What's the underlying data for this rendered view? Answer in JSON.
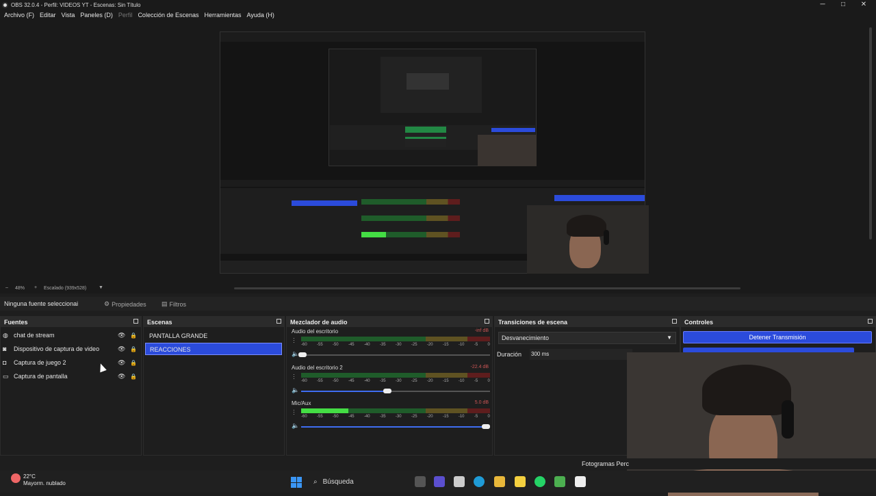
{
  "window": {
    "title": "OBS 32.0.4 - Perfil: VIDEOS YT - Escenas: Sin Título",
    "minimize": "─",
    "maximize": "□",
    "close": "✕"
  },
  "menu": [
    {
      "label": "Archivo (F)",
      "disabled": false
    },
    {
      "label": "Editar",
      "disabled": false
    },
    {
      "label": "Vista",
      "disabled": false
    },
    {
      "label": "Paneles (D)",
      "disabled": false
    },
    {
      "label": "Perfil",
      "disabled": true
    },
    {
      "label": "Colección de Escenas",
      "disabled": false
    },
    {
      "label": "Herramientas",
      "disabled": false
    },
    {
      "label": "Ayuda (H)",
      "disabled": false
    }
  ],
  "zoombar": {
    "minus": "–",
    "zoom": "48%",
    "plus": "+",
    "scale": "Escalado (939x528)"
  },
  "context": {
    "no_source": "Ninguna fuente seleccionai",
    "properties": "Propiedades",
    "filters": "Filtros"
  },
  "sources": {
    "title": "Fuentes",
    "items": [
      {
        "label": "chat de stream",
        "icon": "browser-icon"
      },
      {
        "label": "Dispositivo de captura de video",
        "icon": "camera-icon"
      },
      {
        "label": "Captura de juego 2",
        "icon": "gamepad-icon"
      },
      {
        "label": "Captura de pantalla",
        "icon": "monitor-icon"
      }
    ]
  },
  "scenes": {
    "title": "Escenas",
    "items": [
      {
        "label": "PANTALLA GRANDE",
        "selected": false
      },
      {
        "label": "REACCIONES",
        "selected": true
      }
    ]
  },
  "mixer": {
    "title": "Mezclador de audio",
    "ticks": [
      "-60",
      "-55",
      "-50",
      "-45",
      "-40",
      "-35",
      "-30",
      "-25",
      "-20",
      "-15",
      "-10",
      "-5",
      "0"
    ],
    "channels": [
      {
        "name": "Audio del escritorio",
        "db": "-inf dB",
        "level": 0.0,
        "volume": 0.03
      },
      {
        "name": "Audio del escritorio 2",
        "db": "-22.4 dB",
        "level": 0.0,
        "volume": 0.48
      },
      {
        "name": "Mic/Aux",
        "db": "5.0 dB",
        "level": 0.25,
        "volume": 1.0
      }
    ]
  },
  "transitions": {
    "title": "Transiciones de escena",
    "selected": "Desvanecimiento",
    "duration_label": "Duración",
    "duration_value": "300 ms"
  },
  "controls": {
    "title": "Controles",
    "stop_stream": "Detener Transmisión"
  },
  "status": {
    "frames": "Fotogramas Perc"
  },
  "taskbar": {
    "temp": "22°C",
    "weather": "Mayorm. nublado",
    "search": "Búsqueda"
  },
  "colors": {
    "accent": "#2b4bdb",
    "meter_green": "#44dd44",
    "background": "#1e1e1e"
  }
}
